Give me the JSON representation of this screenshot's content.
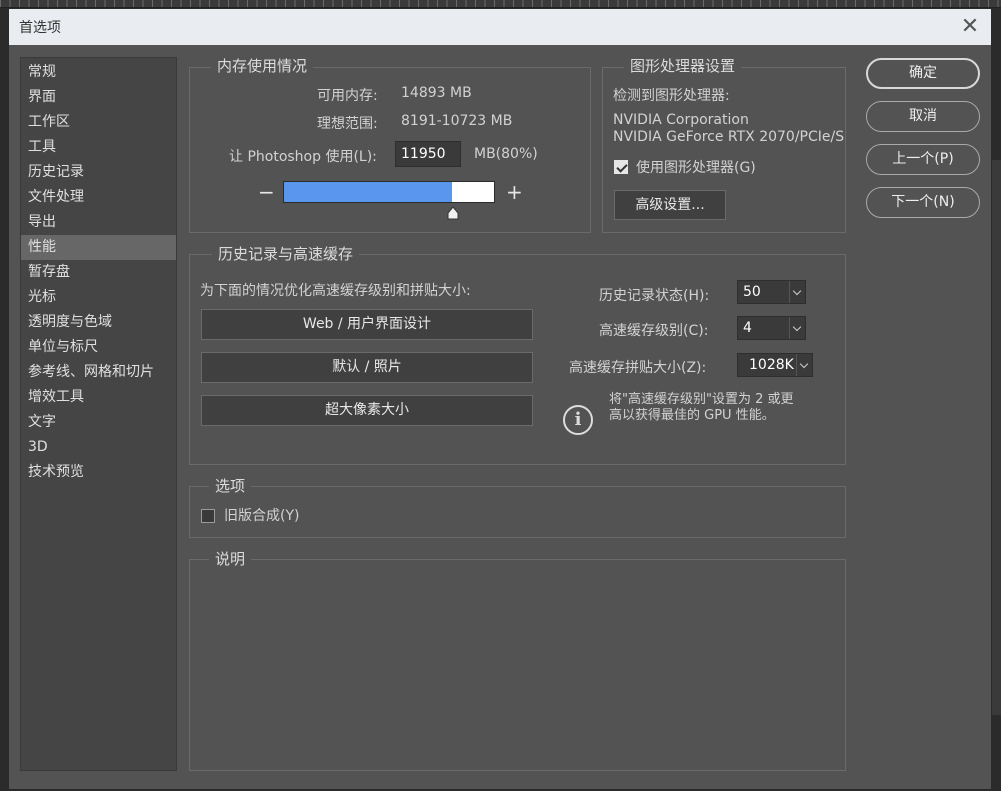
{
  "window": {
    "title": "首选项",
    "close_glyph": "✕"
  },
  "sidebar": {
    "items": [
      {
        "label": "常规"
      },
      {
        "label": "界面"
      },
      {
        "label": "工作区"
      },
      {
        "label": "工具"
      },
      {
        "label": "历史记录"
      },
      {
        "label": "文件处理"
      },
      {
        "label": "导出"
      },
      {
        "label": "性能"
      },
      {
        "label": "暂存盘"
      },
      {
        "label": "光标"
      },
      {
        "label": "透明度与色域"
      },
      {
        "label": "单位与标尺"
      },
      {
        "label": "参考线、网格和切片"
      },
      {
        "label": "增效工具"
      },
      {
        "label": "文字"
      },
      {
        "label": "3D"
      },
      {
        "label": "技术预览"
      }
    ],
    "active": "性能"
  },
  "memory": {
    "heading": "内存使用情况",
    "available_label": "可用内存:",
    "available_value": "14893 MB",
    "ideal_label": "理想范围:",
    "ideal_value": "8191-10723 MB",
    "let_label": "让 Photoshop 使用(L):",
    "let_value": "11950",
    "let_unit": "MB(80%)",
    "slider_percent": 80,
    "minus": "−",
    "plus": "+"
  },
  "gpu": {
    "heading": "图形处理器设置",
    "detected_label": "检测到图形处理器:",
    "vendor": "NVIDIA Corporation",
    "model": "NVIDIA GeForce RTX 2070/PCIe/S",
    "use_gpu_label": "使用图形处理器(G)",
    "use_gpu_checked": true,
    "advanced_button": "高级设置..."
  },
  "history_cache": {
    "heading": "历史记录与高速缓存",
    "optimize_label": "为下面的情况优化高速缓存级别和拼贴大小:",
    "preset_buttons": [
      "Web / 用户界面设计",
      "默认 / 照片",
      "超大像素大小"
    ],
    "history_states_label": "历史记录状态(H):",
    "history_states_value": "50",
    "cache_levels_label": "高速缓存级别(C):",
    "cache_levels_value": "4",
    "cache_tile_label": "高速缓存拼贴大小(Z):",
    "cache_tile_value": "1028K",
    "info_line1": "将\"高速缓存级别\"设置为 2 或更",
    "info_line2": "高以获得最佳的 GPU 性能。",
    "info_glyph": "i"
  },
  "options": {
    "heading": "选项",
    "legacy_label": "旧版合成(Y)",
    "legacy_checked": false
  },
  "description": {
    "heading": "说明"
  },
  "actions": {
    "ok": "确定",
    "cancel": "取消",
    "prev": "上一个(P)",
    "next": "下一个(N)"
  }
}
